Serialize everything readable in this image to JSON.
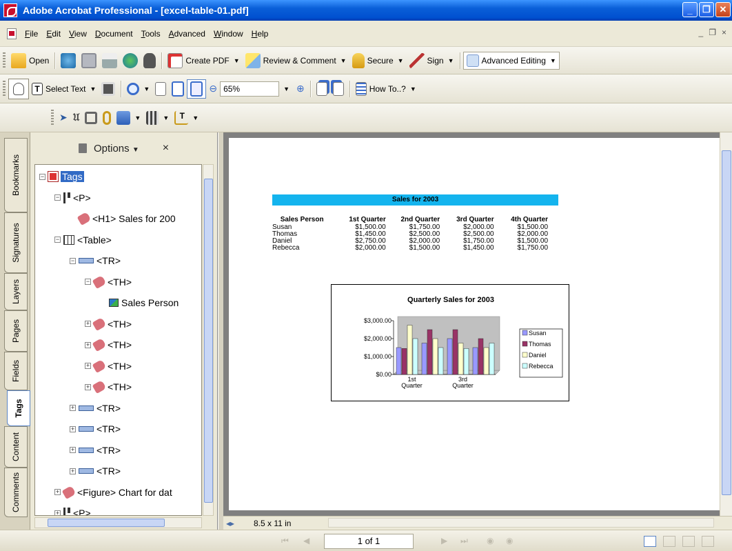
{
  "window": {
    "title": "Adobe Acrobat Professional - [excel-table-01.pdf]",
    "controls": [
      "_",
      "❐",
      "✕"
    ]
  },
  "menubar": {
    "items": [
      "File",
      "Edit",
      "View",
      "Document",
      "Tools",
      "Advanced",
      "Window",
      "Help"
    ],
    "mdi": [
      "_",
      "❐",
      "×"
    ]
  },
  "toolbar1": {
    "open": "Open",
    "create_pdf": "Create PDF",
    "review": "Review & Comment",
    "secure": "Secure",
    "sign": "Sign",
    "advanced_editing": "Advanced Editing"
  },
  "toolbar2": {
    "select_text": "Select Text",
    "zoom": "65%",
    "how_to": "How To..?"
  },
  "left_tabs": [
    "Bookmarks",
    "Signatures",
    "Layers",
    "Pages",
    "Fields",
    "Tags",
    "Content",
    "Comments"
  ],
  "active_tab": "Tags",
  "panel": {
    "options": "Options",
    "close": "×"
  },
  "tree": [
    {
      "label": "Tags",
      "level": 0,
      "toggle": "−",
      "icon": "tags-root"
    },
    {
      "label": "<P>",
      "level": 1,
      "toggle": "−",
      "icon": "paragraph"
    },
    {
      "label": "<H1> Sales for 200",
      "level": 2,
      "toggle": "",
      "icon": "tag"
    },
    {
      "label": "<Table>",
      "level": 1,
      "toggle": "−",
      "icon": "table"
    },
    {
      "label": "<TR>",
      "level": 2,
      "toggle": "−",
      "icon": "row"
    },
    {
      "label": "<TH>",
      "level": 3,
      "toggle": "−",
      "icon": "tag"
    },
    {
      "label": "Sales Person",
      "level": 4,
      "toggle": "",
      "icon": "content"
    },
    {
      "label": "<TH>",
      "level": 3,
      "toggle": "+",
      "icon": "tag"
    },
    {
      "label": "<TH>",
      "level": 3,
      "toggle": "+",
      "icon": "tag"
    },
    {
      "label": "<TH>",
      "level": 3,
      "toggle": "+",
      "icon": "tag"
    },
    {
      "label": "<TH>",
      "level": 3,
      "toggle": "+",
      "icon": "tag"
    },
    {
      "label": "<TR>",
      "level": 2,
      "toggle": "+",
      "icon": "row"
    },
    {
      "label": "<TR>",
      "level": 2,
      "toggle": "+",
      "icon": "row"
    },
    {
      "label": "<TR>",
      "level": 2,
      "toggle": "+",
      "icon": "row"
    },
    {
      "label": "<TR>",
      "level": 2,
      "toggle": "+",
      "icon": "row"
    },
    {
      "label": "<Figure> Chart for dat",
      "level": 1,
      "toggle": "+",
      "icon": "tag"
    },
    {
      "label": "<P>",
      "level": 1,
      "toggle": "+",
      "icon": "paragraph"
    }
  ],
  "document": {
    "heading": "Sales for 2003",
    "table": {
      "headers": [
        "Sales Person",
        "1st Quarter",
        "2nd Quarter",
        "3rd Quarter",
        "4th Quarter"
      ],
      "rows": [
        [
          "Susan",
          "$1,500.00",
          "$1,750.00",
          "$2,000.00",
          "$1,500.00"
        ],
        [
          "Thomas",
          "$1,450.00",
          "$2,500.00",
          "$2,500.00",
          "$2,000.00"
        ],
        [
          "Daniel",
          "$2,750.00",
          "$2,000.00",
          "$1,750.00",
          "$1,500.00"
        ],
        [
          "Rebecca",
          "$2,000.00",
          "$1,500.00",
          "$1,450.00",
          "$1,750.00"
        ]
      ]
    }
  },
  "chart_data": {
    "type": "bar",
    "title": "Quarterly Sales for 2003",
    "categories": [
      "1st Quarter",
      "2nd Quarter",
      "3rd Quarter",
      "4th Quarter"
    ],
    "category_labels_shown": [
      "1st\nQuarter",
      "",
      "3rd\nQuarter",
      ""
    ],
    "series": [
      {
        "name": "Susan",
        "values": [
          1500,
          1750,
          2000,
          1500
        ],
        "color": "#9999ff"
      },
      {
        "name": "Thomas",
        "values": [
          1450,
          2500,
          2500,
          2000
        ],
        "color": "#993366"
      },
      {
        "name": "Daniel",
        "values": [
          2750,
          2000,
          1750,
          1500
        ],
        "color": "#ffffcc"
      },
      {
        "name": "Rebecca",
        "values": [
          2000,
          1500,
          1450,
          1750
        ],
        "color": "#ccffff"
      }
    ],
    "yticks": [
      "$3,000.00",
      "$2,000.00",
      "$1,000.00",
      "$0.00"
    ],
    "ylim": [
      0,
      3000
    ],
    "legend": "right",
    "grid": false
  },
  "doc_status": {
    "page_size": "8.5 x 11 in"
  },
  "bottom": {
    "page_indicator": "1 of 1"
  }
}
